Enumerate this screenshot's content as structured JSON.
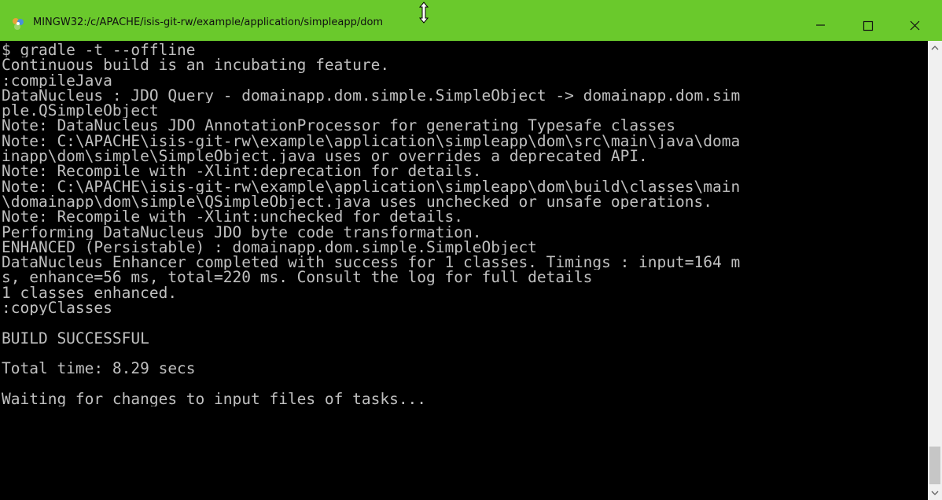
{
  "window": {
    "title": "MINGW32:/c/APACHE/isis-git-rw/example/application/simpleapp/dom",
    "titlebar_color": "#6ac92c",
    "icons": {
      "app": "mingw-app-icon",
      "cursor": "resize-cursor-icon",
      "minimize": "minimize-icon",
      "maximize": "maximize-icon",
      "close": "close-icon"
    }
  },
  "terminal": {
    "text_color": "#c0c0c0",
    "background": "#000000",
    "lines": [
      "$ gradle -t --offline",
      "Continuous build is an incubating feature.",
      ":compileJava",
      "DataNucleus : JDO Query - domainapp.dom.simple.SimpleObject -> domainapp.dom.sim",
      "ple.QSimpleObject",
      "Note: DataNucleus JDO AnnotationProcessor for generating Typesafe classes",
      "Note: C:\\APACHE\\isis-git-rw\\example\\application\\simpleapp\\dom\\src\\main\\java\\doma",
      "inapp\\dom\\simple\\SimpleObject.java uses or overrides a deprecated API.",
      "Note: Recompile with -Xlint:deprecation for details.",
      "Note: C:\\APACHE\\isis-git-rw\\example\\application\\simpleapp\\dom\\build\\classes\\main",
      "\\domainapp\\dom\\simple\\QSimpleObject.java uses unchecked or unsafe operations.",
      "Note: Recompile with -Xlint:unchecked for details.",
      "Performing DataNucleus JDO byte code transformation.",
      "ENHANCED (Persistable) : domainapp.dom.simple.SimpleObject",
      "DataNucleus Enhancer completed with success for 1 classes. Timings : input=164 m",
      "s, enhance=56 ms, total=220 ms. Consult the log for full details",
      "1 classes enhanced.",
      ":copyClasses",
      "",
      "BUILD SUCCESSFUL",
      "",
      "Total time: 8.29 secs",
      "",
      "Waiting for changes to input files of tasks..."
    ]
  }
}
